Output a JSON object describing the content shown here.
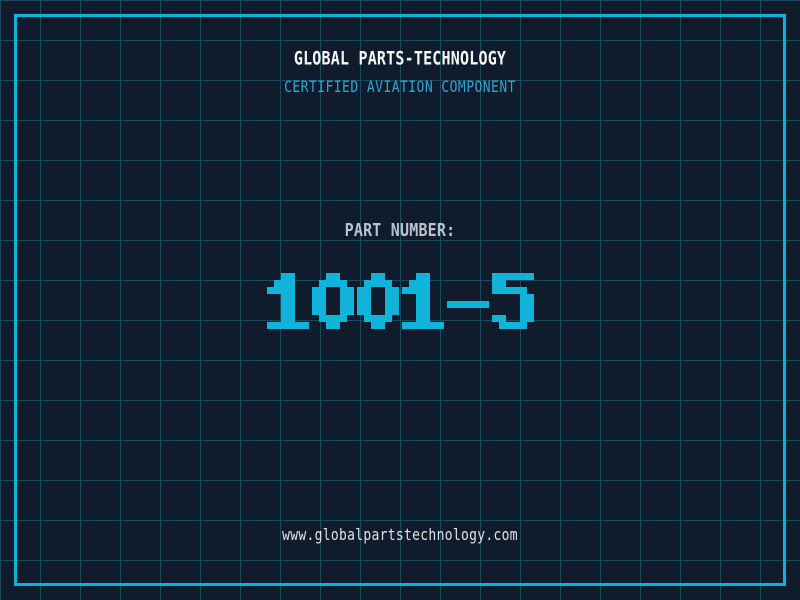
{
  "header": {
    "title": "GLOBAL PARTS-TECHNOLOGY",
    "subtitle": "CERTIFIED AVIATION COMPONENT"
  },
  "part": {
    "label": "PART NUMBER:",
    "number": "1001-5"
  },
  "footer": {
    "website": "www.globalpartstechnology.com"
  },
  "colors": {
    "background": "#101b2b",
    "grid_line": "#1c4a5e",
    "frame_border": "#0ab5dc",
    "title_text": "#f5f7f8",
    "subtitle_text": "#2ba7d3",
    "part_label_text": "#b9c3cd",
    "part_number_text": "#10b3da",
    "footer_text": "#dfe3e6"
  }
}
